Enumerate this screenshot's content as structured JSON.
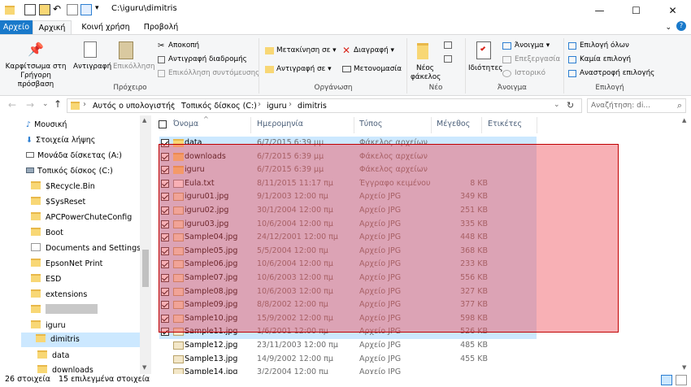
{
  "window": {
    "title": "C:\\iguru\\dimitris",
    "minimize": "—",
    "maximize": "☐",
    "close": "✕"
  },
  "tabs": [
    "Αρχείο",
    "Αρχική",
    "Κοινή χρήση",
    "Προβολή"
  ],
  "ribbon": {
    "pin": "Καρφίτσωμα στη Γρήγορη πρόσβαση",
    "copy": "Αντιγραφή",
    "paste": "Επικόλληση",
    "cut": "Αποκοπή",
    "copy_path": "Αντιγραφή διαδρομής",
    "paste_shortcut": "Επικόλληση συντόμευσης",
    "group_clipboard": "Πρόχειρο",
    "move_to": "Μετακίνηση σε ▾",
    "copy_to": "Αντιγραφή σε ▾",
    "delete": "Διαγραφή ▾",
    "rename": "Μετονομασία",
    "group_organize": "Οργάνωση",
    "new_folder": "Νέος φάκελος",
    "group_new": "Νέο",
    "properties": "Ιδιότητες",
    "open": "Άνοιγμα ▾",
    "edit": "Επεξεργασία",
    "history": "Ιστορικό",
    "group_open": "Άνοιγμα",
    "select_all": "Επιλογή όλων",
    "select_none": "Καμία επιλογή",
    "invert_selection": "Αναστροφή επιλογής",
    "group_select": "Επιλογή"
  },
  "address": {
    "crumbs": [
      "Αυτός ο υπολογιστής",
      "Τοπικός δίσκος (C:)",
      "iguru",
      "dimitris"
    ],
    "search_placeholder": "Αναζήτηση: di..."
  },
  "tree": [
    "Μουσική",
    "Στοιχεία λήψης",
    "Μονάδα δίσκετας (A:)",
    "Τοπικός δίσκος (C:)",
    "$Recycle.Bin",
    "$SysReset",
    "APCPowerChuteConfig",
    "Boot",
    "Documents and Settings",
    "EpsonNet Print",
    "ESD",
    "extensions",
    "",
    "iguru",
    "dimitris",
    "data",
    "downloads"
  ],
  "columns": [
    "Όνομα",
    "Ημερομηνία",
    "Τύπος",
    "Μέγεθος",
    "Ετικέτες"
  ],
  "files": [
    {
      "name": "data",
      "date": "6/7/2015 6:39 μμ",
      "type": "Φάκελος αρχείων",
      "size": "",
      "kind": "folder",
      "selected": true
    },
    {
      "name": "downloads",
      "date": "6/7/2015 6:39 μμ",
      "type": "Φάκελος αρχείων",
      "size": "",
      "kind": "folder",
      "selected": true
    },
    {
      "name": "iguru",
      "date": "6/7/2015 6:39 μμ",
      "type": "Φάκελος αρχείων",
      "size": "",
      "kind": "folder",
      "selected": true
    },
    {
      "name": "Eula.txt",
      "date": "8/11/2015 11:17 πμ",
      "type": "Έγγραφο κειμένου",
      "size": "8 KB",
      "kind": "txt",
      "selected": true
    },
    {
      "name": "iguru01.jpg",
      "date": "9/1/2003 12:00 πμ",
      "type": "Αρχείο JPG",
      "size": "349 KB",
      "kind": "jpg",
      "selected": true
    },
    {
      "name": "iguru02.jpg",
      "date": "30/1/2004 12:00 πμ",
      "type": "Αρχείο JPG",
      "size": "251 KB",
      "kind": "jpg",
      "selected": true
    },
    {
      "name": "iguru03.jpg",
      "date": "10/6/2004 12:00 πμ",
      "type": "Αρχείο JPG",
      "size": "335 KB",
      "kind": "jpg",
      "selected": true
    },
    {
      "name": "Sample04.jpg",
      "date": "24/12/2001 12:00 πμ",
      "type": "Αρχείο JPG",
      "size": "448 KB",
      "kind": "jpg",
      "selected": true
    },
    {
      "name": "Sample05.jpg",
      "date": "5/5/2004 12:00 πμ",
      "type": "Αρχείο JPG",
      "size": "368 KB",
      "kind": "jpg",
      "selected": true
    },
    {
      "name": "Sample06.jpg",
      "date": "10/6/2004 12:00 πμ",
      "type": "Αρχείο JPG",
      "size": "233 KB",
      "kind": "jpg",
      "selected": true
    },
    {
      "name": "Sample07.jpg",
      "date": "10/6/2003 12:00 πμ",
      "type": "Αρχείο JPG",
      "size": "556 KB",
      "kind": "jpg",
      "selected": true
    },
    {
      "name": "Sample08.jpg",
      "date": "10/6/2003 12:00 πμ",
      "type": "Αρχείο JPG",
      "size": "327 KB",
      "kind": "jpg",
      "selected": true
    },
    {
      "name": "Sample09.jpg",
      "date": "8/8/2002 12:00 πμ",
      "type": "Αρχείο JPG",
      "size": "377 KB",
      "kind": "jpg",
      "selected": true
    },
    {
      "name": "Sample10.jpg",
      "date": "15/9/2002 12:00 πμ",
      "type": "Αρχείο JPG",
      "size": "598 KB",
      "kind": "jpg",
      "selected": true
    },
    {
      "name": "Sample11.jpg",
      "date": "1/6/2001 12:00 πμ",
      "type": "Αρχείο JPG",
      "size": "526 KB",
      "kind": "jpg",
      "selected": true
    },
    {
      "name": "Sample12.jpg",
      "date": "23/11/2003 12:00 πμ",
      "type": "Αρχείο JPG",
      "size": "485 KB",
      "kind": "jpg",
      "selected": false
    },
    {
      "name": "Sample13.jpg",
      "date": "14/9/2002 12:00 πμ",
      "type": "Αρχείο JPG",
      "size": "455 KB",
      "kind": "jpg",
      "selected": false
    },
    {
      "name": "Sample14.jpg",
      "date": "3/2/2004 12:00 πμ",
      "type": "Αρχείο JPG",
      "size": "",
      "kind": "jpg",
      "selected": false
    }
  ],
  "status": {
    "count": "26 στοιχεία",
    "selected": "15 επιλεγμένα στοιχεία"
  },
  "colors": {
    "accent": "#1979ca",
    "selection": "#cce8ff",
    "overlay": "#f0505a"
  }
}
